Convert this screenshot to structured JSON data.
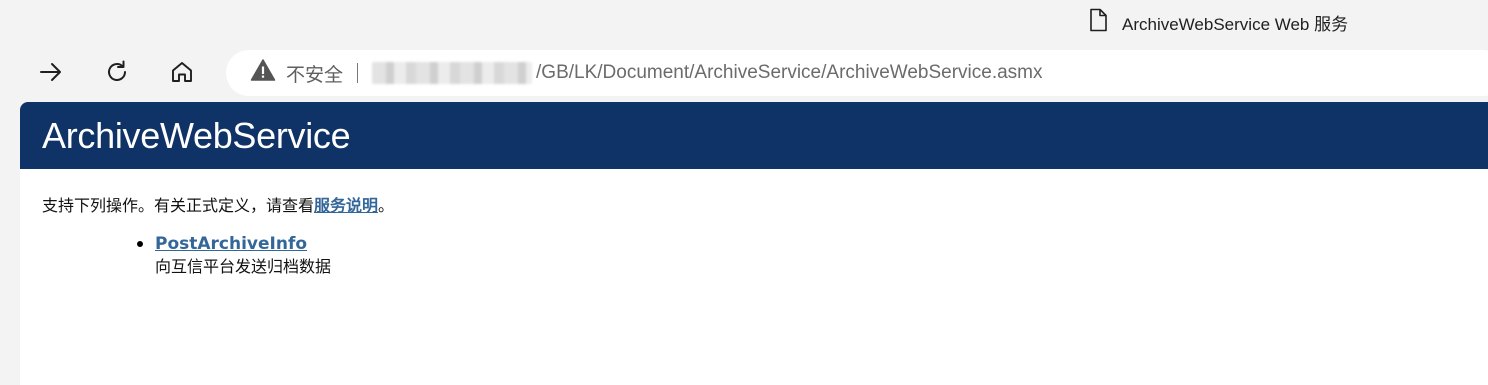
{
  "tab": {
    "title": "ArchiveWebService Web 服务",
    "icon": "document-icon"
  },
  "toolbar": {
    "forward_icon": "arrow-right-icon",
    "reload_icon": "reload-icon",
    "home_icon": "home-icon"
  },
  "address": {
    "security_label": "不安全",
    "security_icon": "warning-icon",
    "url_visible": "/GB/LK/Document/ArchiveService/ArchiveWebService.asmx"
  },
  "page": {
    "heading": "ArchiveWebService",
    "intro_text": "支持下列操作。有关正式定义，请查看",
    "intro_link": "服务说明",
    "intro_end": "。",
    "operations": [
      {
        "name": "PostArchiveInfo",
        "description": "向互信平台发送归档数据"
      }
    ]
  },
  "colors": {
    "header_bg": "#0f3366",
    "link": "#336699"
  }
}
